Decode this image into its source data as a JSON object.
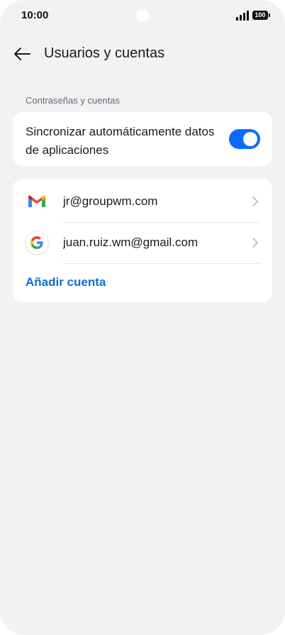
{
  "status_bar": {
    "time": "10:00",
    "battery": "100",
    "signal_icon": "signal-bars-icon"
  },
  "header": {
    "title": "Usuarios y cuentas",
    "back_icon": "arrow-left-icon"
  },
  "section": {
    "label": "Contraseñas y cuentas"
  },
  "sync": {
    "label": "Sincronizar automáticamente datos de aplicaciones",
    "enabled": true,
    "toggle_color": "#0a6cff"
  },
  "accounts": [
    {
      "email": "jr@groupwm.com",
      "icon": "gmail-icon"
    },
    {
      "email": "juan.ruiz.wm@gmail.com",
      "icon": "google-icon"
    }
  ],
  "add_account_label": "Añadir cuenta",
  "colors": {
    "background": "#f1f2f4",
    "card": "#ffffff",
    "accent": "#0a6cd8"
  }
}
